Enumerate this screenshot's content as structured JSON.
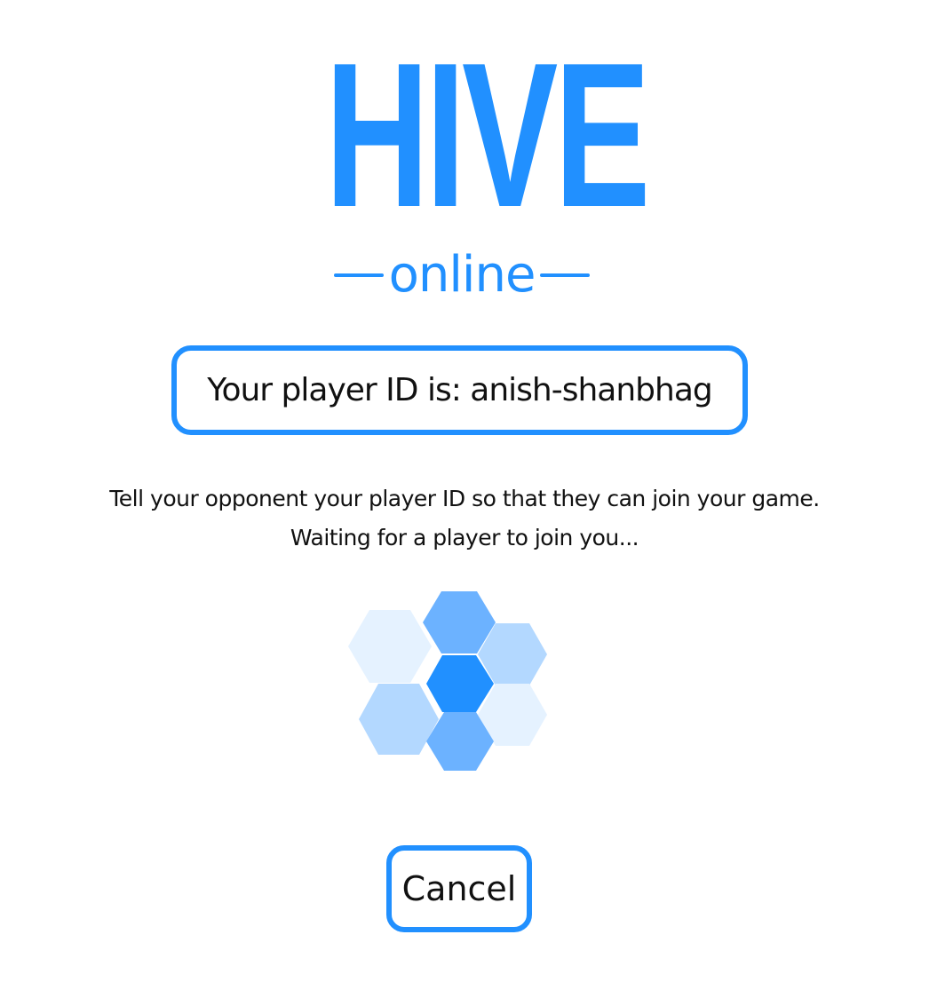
{
  "logo": {
    "title": "HIVE",
    "subtitle": "online"
  },
  "player_id": {
    "text": "Your player ID is: anish-shanbhag"
  },
  "message": {
    "line1": "Tell your opponent your player ID so that they can join your game.",
    "line2": "Waiting for a player to join you..."
  },
  "cancel": {
    "label": "Cancel"
  },
  "colors": {
    "accent": "#2190ff",
    "hex_mid": "#6cb2ff",
    "hex_light": "#b3d8ff",
    "hex_faint": "#e5f2ff",
    "text": "#111111"
  },
  "spinner": {
    "icon": "hexagon-loading-icon"
  }
}
